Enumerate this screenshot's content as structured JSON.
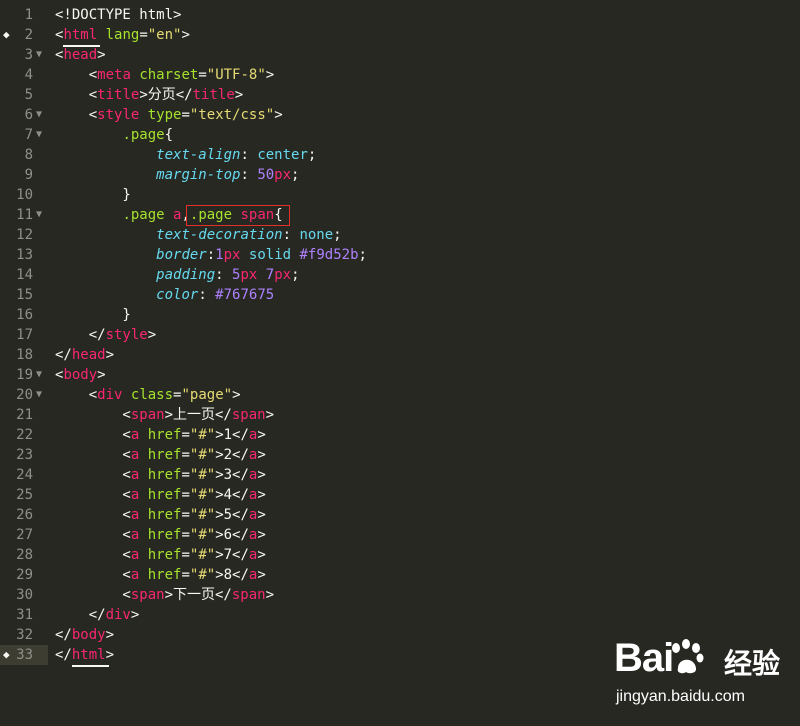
{
  "editor": {
    "lines": [
      {
        "n": "1",
        "segs": [
          {
            "t": "<!DOCTYPE html>",
            "c": "plain"
          }
        ]
      },
      {
        "n": "2",
        "segs": [
          {
            "t": "<",
            "c": "plain"
          },
          {
            "t": "html",
            "c": "tag"
          },
          {
            "t": " ",
            "c": "plain"
          },
          {
            "t": "lang",
            "c": "attr"
          },
          {
            "t": "=",
            "c": "plain"
          },
          {
            "t": "\"en\"",
            "c": "str"
          },
          {
            "t": ">",
            "c": "plain"
          }
        ]
      },
      {
        "n": "3",
        "segs": [
          {
            "t": "<",
            "c": "plain"
          },
          {
            "t": "head",
            "c": "tag"
          },
          {
            "t": ">",
            "c": "plain"
          }
        ]
      },
      {
        "n": "4",
        "segs": [
          {
            "t": "    <",
            "c": "plain"
          },
          {
            "t": "meta",
            "c": "tag"
          },
          {
            "t": " ",
            "c": "plain"
          },
          {
            "t": "charset",
            "c": "attr"
          },
          {
            "t": "=",
            "c": "plain"
          },
          {
            "t": "\"UTF-8\"",
            "c": "str"
          },
          {
            "t": ">",
            "c": "plain"
          }
        ]
      },
      {
        "n": "5",
        "segs": [
          {
            "t": "    <",
            "c": "plain"
          },
          {
            "t": "title",
            "c": "tag"
          },
          {
            "t": ">分页</",
            "c": "plain"
          },
          {
            "t": "title",
            "c": "tag"
          },
          {
            "t": ">",
            "c": "plain"
          }
        ]
      },
      {
        "n": "6",
        "segs": [
          {
            "t": "    <",
            "c": "plain"
          },
          {
            "t": "style",
            "c": "tag"
          },
          {
            "t": " ",
            "c": "plain"
          },
          {
            "t": "type",
            "c": "attr"
          },
          {
            "t": "=",
            "c": "plain"
          },
          {
            "t": "\"text/css\"",
            "c": "str"
          },
          {
            "t": ">",
            "c": "plain"
          }
        ]
      },
      {
        "n": "7",
        "segs": [
          {
            "t": "        ",
            "c": "plain"
          },
          {
            "t": ".page",
            "c": "sel"
          },
          {
            "t": "{",
            "c": "plain"
          }
        ]
      },
      {
        "n": "8",
        "segs": [
          {
            "t": "            ",
            "c": "plain"
          },
          {
            "t": "text-align",
            "c": "prop"
          },
          {
            "t": ": ",
            "c": "plain"
          },
          {
            "t": "center",
            "c": "prop2"
          },
          {
            "t": ";",
            "c": "plain"
          }
        ]
      },
      {
        "n": "9",
        "segs": [
          {
            "t": "            ",
            "c": "plain"
          },
          {
            "t": "margin-top",
            "c": "prop"
          },
          {
            "t": ": ",
            "c": "plain"
          },
          {
            "t": "50",
            "c": "num"
          },
          {
            "t": "px",
            "c": "tag"
          },
          {
            "t": ";",
            "c": "plain"
          }
        ]
      },
      {
        "n": "10",
        "segs": [
          {
            "t": "        }",
            "c": "plain"
          }
        ]
      },
      {
        "n": "11",
        "segs": [
          {
            "t": "        ",
            "c": "plain"
          },
          {
            "t": ".page ",
            "c": "sel"
          },
          {
            "t": "a",
            "c": "tag"
          },
          {
            "t": ",",
            "c": "plain"
          },
          {
            "t": ".page ",
            "c": "sel"
          },
          {
            "t": "span",
            "c": "tag"
          },
          {
            "t": "{",
            "c": "plain"
          }
        ]
      },
      {
        "n": "12",
        "segs": [
          {
            "t": "            ",
            "c": "plain"
          },
          {
            "t": "text-decoration",
            "c": "prop"
          },
          {
            "t": ": ",
            "c": "plain"
          },
          {
            "t": "none",
            "c": "prop2"
          },
          {
            "t": ";",
            "c": "plain"
          }
        ]
      },
      {
        "n": "13",
        "segs": [
          {
            "t": "            ",
            "c": "plain"
          },
          {
            "t": "border",
            "c": "prop"
          },
          {
            "t": ":",
            "c": "plain"
          },
          {
            "t": "1",
            "c": "num"
          },
          {
            "t": "px",
            "c": "tag"
          },
          {
            "t": " ",
            "c": "plain"
          },
          {
            "t": "solid",
            "c": "prop2"
          },
          {
            "t": " ",
            "c": "plain"
          },
          {
            "t": "#f9d52b",
            "c": "num"
          },
          {
            "t": ";",
            "c": "plain"
          }
        ]
      },
      {
        "n": "14",
        "segs": [
          {
            "t": "            ",
            "c": "plain"
          },
          {
            "t": "padding",
            "c": "prop"
          },
          {
            "t": ": ",
            "c": "plain"
          },
          {
            "t": "5",
            "c": "num"
          },
          {
            "t": "px",
            "c": "tag"
          },
          {
            "t": " ",
            "c": "plain"
          },
          {
            "t": "7",
            "c": "num"
          },
          {
            "t": "px",
            "c": "tag"
          },
          {
            "t": ";",
            "c": "plain"
          }
        ]
      },
      {
        "n": "15",
        "segs": [
          {
            "t": "            ",
            "c": "plain"
          },
          {
            "t": "color",
            "c": "prop"
          },
          {
            "t": ": ",
            "c": "plain"
          },
          {
            "t": "#767675",
            "c": "num"
          }
        ]
      },
      {
        "n": "16",
        "segs": [
          {
            "t": "        }",
            "c": "plain"
          }
        ]
      },
      {
        "n": "17",
        "segs": [
          {
            "t": "    </",
            "c": "plain"
          },
          {
            "t": "style",
            "c": "tag"
          },
          {
            "t": ">",
            "c": "plain"
          }
        ]
      },
      {
        "n": "18",
        "segs": [
          {
            "t": "</",
            "c": "plain"
          },
          {
            "t": "head",
            "c": "tag"
          },
          {
            "t": ">",
            "c": "plain"
          }
        ]
      },
      {
        "n": "19",
        "segs": [
          {
            "t": "<",
            "c": "plain"
          },
          {
            "t": "body",
            "c": "tag"
          },
          {
            "t": ">",
            "c": "plain"
          }
        ]
      },
      {
        "n": "20",
        "segs": [
          {
            "t": "    <",
            "c": "plain"
          },
          {
            "t": "div",
            "c": "tag"
          },
          {
            "t": " ",
            "c": "plain"
          },
          {
            "t": "class",
            "c": "attr"
          },
          {
            "t": "=",
            "c": "plain"
          },
          {
            "t": "\"page\"",
            "c": "str"
          },
          {
            "t": ">",
            "c": "plain"
          }
        ]
      },
      {
        "n": "21",
        "segs": [
          {
            "t": "        <",
            "c": "plain"
          },
          {
            "t": "span",
            "c": "tag"
          },
          {
            "t": ">上一页</",
            "c": "plain"
          },
          {
            "t": "span",
            "c": "tag"
          },
          {
            "t": ">",
            "c": "plain"
          }
        ]
      },
      {
        "n": "22",
        "segs": [
          {
            "t": "        <",
            "c": "plain"
          },
          {
            "t": "a",
            "c": "tag"
          },
          {
            "t": " ",
            "c": "plain"
          },
          {
            "t": "href",
            "c": "attr"
          },
          {
            "t": "=",
            "c": "plain"
          },
          {
            "t": "\"#\"",
            "c": "str"
          },
          {
            "t": ">1</",
            "c": "plain"
          },
          {
            "t": "a",
            "c": "tag"
          },
          {
            "t": ">",
            "c": "plain"
          }
        ]
      },
      {
        "n": "23",
        "segs": [
          {
            "t": "        <",
            "c": "plain"
          },
          {
            "t": "a",
            "c": "tag"
          },
          {
            "t": " ",
            "c": "plain"
          },
          {
            "t": "href",
            "c": "attr"
          },
          {
            "t": "=",
            "c": "plain"
          },
          {
            "t": "\"#\"",
            "c": "str"
          },
          {
            "t": ">2</",
            "c": "plain"
          },
          {
            "t": "a",
            "c": "tag"
          },
          {
            "t": ">",
            "c": "plain"
          }
        ]
      },
      {
        "n": "24",
        "segs": [
          {
            "t": "        <",
            "c": "plain"
          },
          {
            "t": "a",
            "c": "tag"
          },
          {
            "t": " ",
            "c": "plain"
          },
          {
            "t": "href",
            "c": "attr"
          },
          {
            "t": "=",
            "c": "plain"
          },
          {
            "t": "\"#\"",
            "c": "str"
          },
          {
            "t": ">3</",
            "c": "plain"
          },
          {
            "t": "a",
            "c": "tag"
          },
          {
            "t": ">",
            "c": "plain"
          }
        ]
      },
      {
        "n": "25",
        "segs": [
          {
            "t": "        <",
            "c": "plain"
          },
          {
            "t": "a",
            "c": "tag"
          },
          {
            "t": " ",
            "c": "plain"
          },
          {
            "t": "href",
            "c": "attr"
          },
          {
            "t": "=",
            "c": "plain"
          },
          {
            "t": "\"#\"",
            "c": "str"
          },
          {
            "t": ">4</",
            "c": "plain"
          },
          {
            "t": "a",
            "c": "tag"
          },
          {
            "t": ">",
            "c": "plain"
          }
        ]
      },
      {
        "n": "26",
        "segs": [
          {
            "t": "        <",
            "c": "plain"
          },
          {
            "t": "a",
            "c": "tag"
          },
          {
            "t": " ",
            "c": "plain"
          },
          {
            "t": "href",
            "c": "attr"
          },
          {
            "t": "=",
            "c": "plain"
          },
          {
            "t": "\"#\"",
            "c": "str"
          },
          {
            "t": ">5</",
            "c": "plain"
          },
          {
            "t": "a",
            "c": "tag"
          },
          {
            "t": ">",
            "c": "plain"
          }
        ]
      },
      {
        "n": "27",
        "segs": [
          {
            "t": "        <",
            "c": "plain"
          },
          {
            "t": "a",
            "c": "tag"
          },
          {
            "t": " ",
            "c": "plain"
          },
          {
            "t": "href",
            "c": "attr"
          },
          {
            "t": "=",
            "c": "plain"
          },
          {
            "t": "\"#\"",
            "c": "str"
          },
          {
            "t": ">6</",
            "c": "plain"
          },
          {
            "t": "a",
            "c": "tag"
          },
          {
            "t": ">",
            "c": "plain"
          }
        ]
      },
      {
        "n": "28",
        "segs": [
          {
            "t": "        <",
            "c": "plain"
          },
          {
            "t": "a",
            "c": "tag"
          },
          {
            "t": " ",
            "c": "plain"
          },
          {
            "t": "href",
            "c": "attr"
          },
          {
            "t": "=",
            "c": "plain"
          },
          {
            "t": "\"#\"",
            "c": "str"
          },
          {
            "t": ">7</",
            "c": "plain"
          },
          {
            "t": "a",
            "c": "tag"
          },
          {
            "t": ">",
            "c": "plain"
          }
        ]
      },
      {
        "n": "29",
        "segs": [
          {
            "t": "        <",
            "c": "plain"
          },
          {
            "t": "a",
            "c": "tag"
          },
          {
            "t": " ",
            "c": "plain"
          },
          {
            "t": "href",
            "c": "attr"
          },
          {
            "t": "=",
            "c": "plain"
          },
          {
            "t": "\"#\"",
            "c": "str"
          },
          {
            "t": ">8</",
            "c": "plain"
          },
          {
            "t": "a",
            "c": "tag"
          },
          {
            "t": ">",
            "c": "plain"
          }
        ]
      },
      {
        "n": "30",
        "segs": [
          {
            "t": "        <",
            "c": "plain"
          },
          {
            "t": "span",
            "c": "tag"
          },
          {
            "t": ">下一页</",
            "c": "plain"
          },
          {
            "t": "span",
            "c": "tag"
          },
          {
            "t": ">",
            "c": "plain"
          }
        ]
      },
      {
        "n": "31",
        "segs": [
          {
            "t": "    </",
            "c": "plain"
          },
          {
            "t": "div",
            "c": "tag"
          },
          {
            "t": ">",
            "c": "plain"
          }
        ]
      },
      {
        "n": "32",
        "segs": [
          {
            "t": "</",
            "c": "plain"
          },
          {
            "t": "body",
            "c": "tag"
          },
          {
            "t": ">",
            "c": "plain"
          }
        ]
      },
      {
        "n": "33",
        "segs": [
          {
            "t": "</",
            "c": "plain"
          },
          {
            "t": "html",
            "c": "tag"
          },
          {
            "t": ">",
            "c": "plain"
          }
        ]
      }
    ],
    "fold_lines": [
      "3",
      "6",
      "7",
      "11",
      "19",
      "20"
    ],
    "bookmark_lines": [
      "2",
      "33"
    ],
    "colors": {
      "background": "#272822",
      "text": "#f8f8f2",
      "tag": "#f92672",
      "attribute": "#a6e22e",
      "string": "#e6db74",
      "property": "#66d9ef",
      "number": "#ae81ff",
      "gutter_text": "#8f908a",
      "highlight_box": "#e1302a"
    }
  },
  "watermark": {
    "logo": "Bai",
    "logo_suffix": "经验",
    "url": "jingyan.baidu.com"
  }
}
